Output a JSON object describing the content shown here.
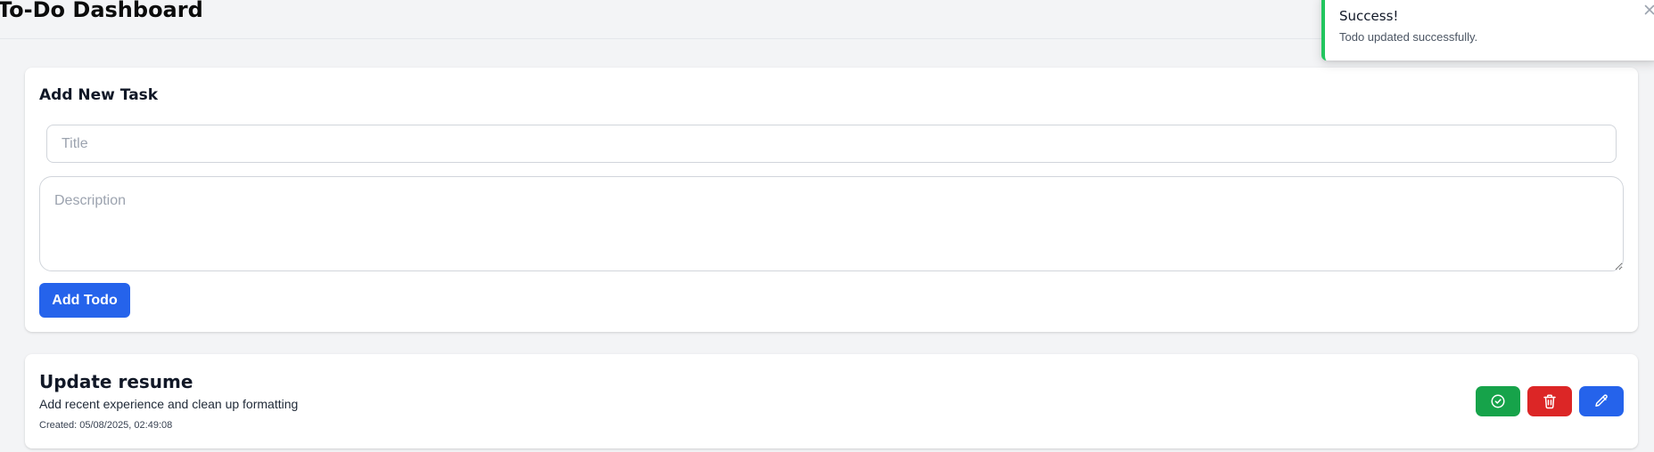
{
  "header": {
    "title": "To-Do Dashboard"
  },
  "form": {
    "heading": "Add New Task",
    "title_placeholder": "Title",
    "title_value": "",
    "description_placeholder": "Description",
    "description_value": "",
    "submit_label": "Add Todo"
  },
  "todos": [
    {
      "title": "Update resume",
      "description": "Add recent experience and clean up formatting",
      "created": "Created: 05/08/2025, 02:49:08",
      "actions": [
        {
          "name": "complete-button",
          "icon": "check-circle-icon",
          "color": "#16a34a"
        },
        {
          "name": "delete-button",
          "icon": "trash-icon",
          "color": "#dc2626"
        },
        {
          "name": "edit-button",
          "icon": "pencil-icon",
          "color": "#2563eb"
        }
      ]
    }
  ],
  "toast": {
    "title": "Success!",
    "message": "Todo updated successfully.",
    "close_icon": "close-icon",
    "accent": "#22c55e"
  },
  "colors": {
    "background": "#f3f4f6",
    "primary": "#2563eb",
    "success": "#16a34a",
    "danger": "#dc2626"
  }
}
